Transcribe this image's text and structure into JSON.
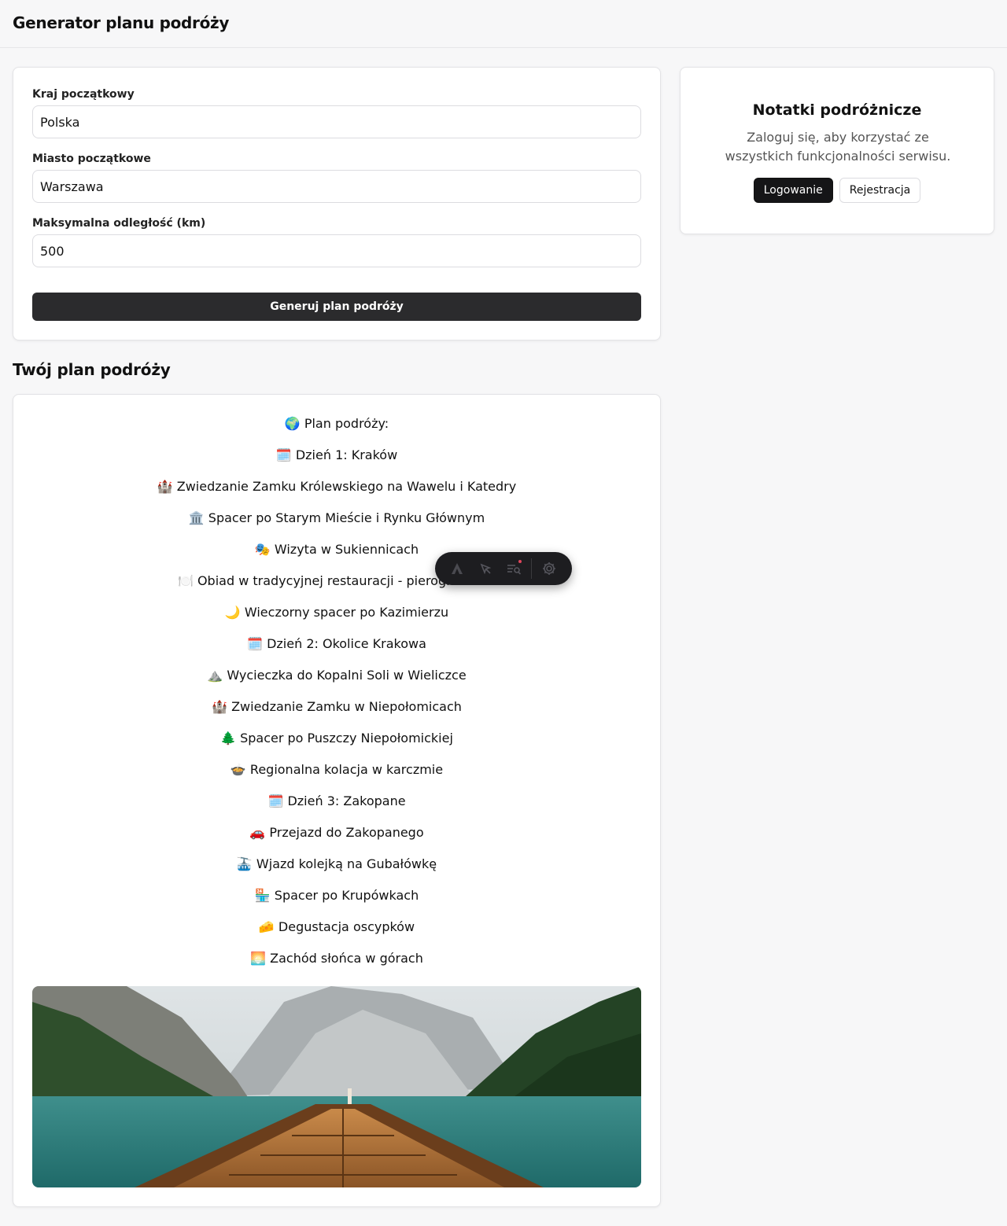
{
  "header": {
    "title": "Generator planu podróży"
  },
  "form": {
    "country": {
      "label": "Kraj początkowy",
      "value": "Polska"
    },
    "city": {
      "label": "Miasto początkowe",
      "value": "Warszawa"
    },
    "distance": {
      "label": "Maksymalna odległość (km)",
      "value": "500"
    },
    "generate_label": "Generuj plan podróży"
  },
  "notes": {
    "title": "Notatki podróżnicze",
    "message": "Zaloguj się, aby korzystać ze wszystkich funkcjonalności serwisu.",
    "login_label": "Logowanie",
    "register_label": "Rejestracja"
  },
  "plan": {
    "title": "Twój plan podróży",
    "items": [
      "🌍 Plan podróży:",
      "🗓️ Dzień 1: Kraków",
      "🏰 Zwiedzanie Zamku Królewskiego na Wawelu i Katedry",
      "🏛️ Spacer po Starym Mieście i Rynku Głównym",
      "🎭 Wizyta w Sukiennicach",
      "🍽️ Obiad w tradycyjnej restauracji - pierogi i żurek",
      "🌙 Wieczorny spacer po Kazimierzu",
      "🗓️ Dzień 2: Okolice Krakowa",
      "⛰️ Wycieczka do Kopalni Soli w Wieliczce",
      "🏰 Zwiedzanie Zamku w Niepołomicach",
      "🌲 Spacer po Puszczy Niepołomickiej",
      "🍲 Regionalna kolacja w karczmie",
      "🗓️ Dzień 3: Zakopane",
      "🚗 Przejazd do Zakopanego",
      "🚠 Wjazd kolejką na Gubałówkę",
      "🏪 Spacer po Krupówkach",
      "🧀 Degustacja oscypków",
      "🌅 Zachód słońca w górach"
    ]
  },
  "toolbar": {
    "icons": [
      "brand-icon",
      "cursor-select-icon",
      "inspect-list-icon",
      "settings-gear-icon"
    ],
    "notification_color": "#e0455b"
  },
  "colors": {
    "primary_button": "#2b2b2d",
    "dark_button": "#151517",
    "page_background": "#f7f7f8"
  }
}
